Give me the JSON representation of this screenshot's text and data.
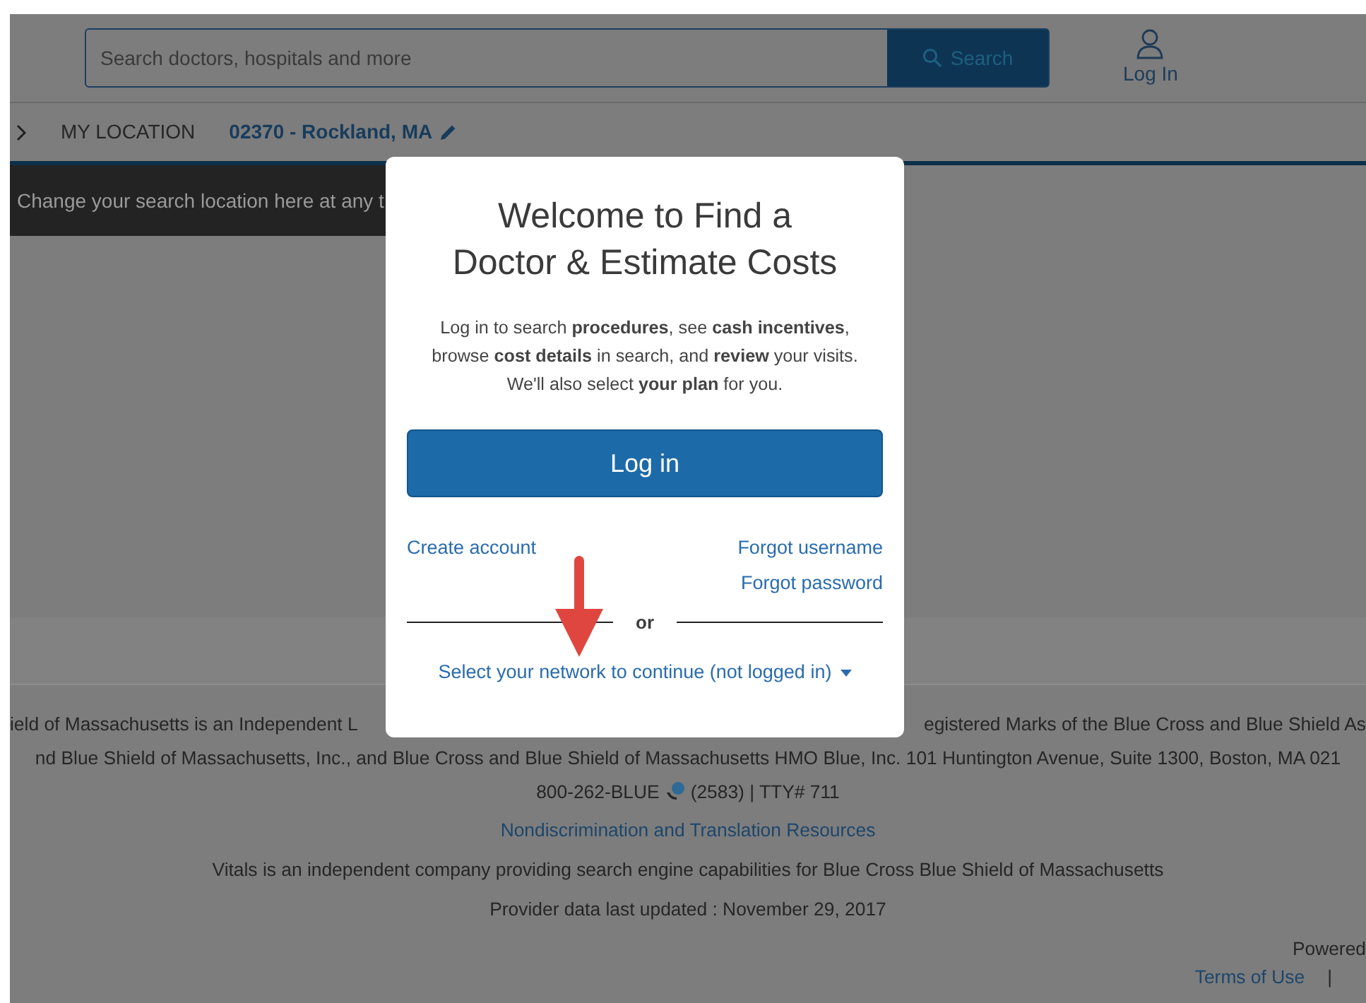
{
  "header": {
    "search": {
      "placeholder": "Search doctors, hospitals and more"
    },
    "search_button": "Search",
    "login": "Log In"
  },
  "location_bar": {
    "label": "MY LOCATION",
    "location": "02370 - Rockland, MA"
  },
  "tooltip": "Change your search location here at any t",
  "footer": {
    "line_1_left": "ield of Massachusetts is an Independent L",
    "line_1_right": "egistered Marks of the Blue Cross and Blue Shield As",
    "line_2": "nd Blue Shield of Massachusetts, Inc., and Blue Cross and Blue Shield of Massachusetts HMO Blue, Inc. 101 Huntington Avenue, Suite 1300, Boston, MA 021",
    "phone": "800-262-BLUE",
    "phone_rest": "(2583) | TTY# 711",
    "link": "Nondiscrimination and Translation Resources",
    "vitals": "Vitals is an independent company providing search engine capabilities for Blue Cross Blue Shield of Massachusetts",
    "updated": "Provider data last updated : November 29, 2017",
    "powered": "Powered",
    "terms": "Terms of Use",
    "separator": "|"
  },
  "modal": {
    "title": [
      "Welcome to Find a",
      "Doctor & Estimate Costs"
    ],
    "intro": "Log in to search **procedures**, see **cash incentives**, browse **cost details** in search, and **review** your visits. We'll also select **your plan** for you.",
    "login_button": "Log in",
    "create_account": "Create account",
    "forgot_username": "Forgot username",
    "forgot_password": "Forgot password",
    "divider": "or",
    "network_select": "Select your network to continue (not logged in)"
  }
}
